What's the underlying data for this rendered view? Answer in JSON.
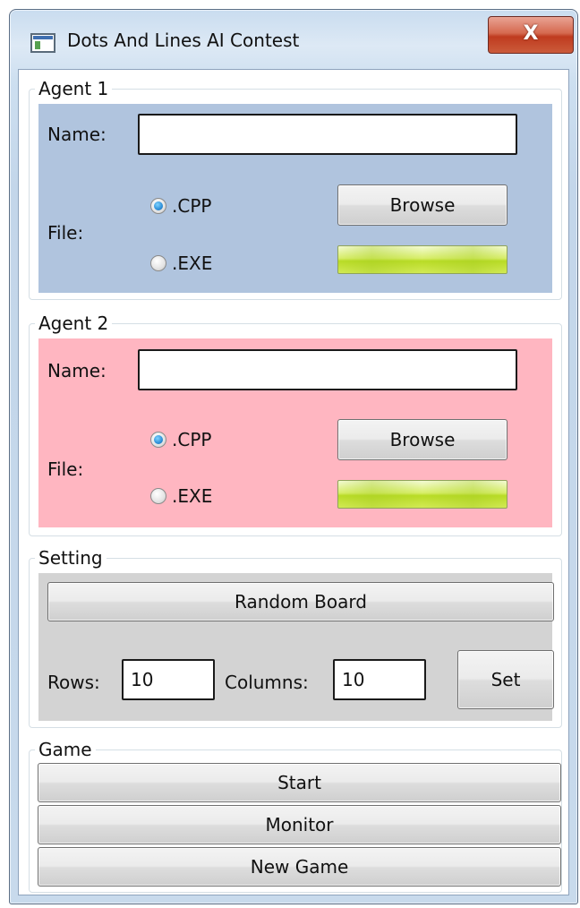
{
  "window": {
    "title": "Dots And Lines AI Contest",
    "close_glyph": "X"
  },
  "agent1": {
    "header": "Agent 1",
    "name_label": "Name:",
    "name_value": "",
    "file_label": "File:",
    "radio_cpp": ".CPP",
    "radio_exe": ".EXE",
    "selected": ".CPP",
    "browse_label": "Browse",
    "progress": 1.0,
    "panel_color": "#b0c4de"
  },
  "agent2": {
    "header": "Agent 2",
    "name_label": "Name:",
    "name_value": "",
    "file_label": "File:",
    "radio_cpp": ".CPP",
    "radio_exe": ".EXE",
    "selected": ".CPP",
    "browse_label": "Browse",
    "progress": 1.0,
    "panel_color": "#ffb6c1"
  },
  "setting": {
    "header": "Setting",
    "random_board_label": "Random Board",
    "rows_label": "Rows:",
    "rows_value": "10",
    "columns_label": "Columns:",
    "columns_value": "10",
    "set_label": "Set",
    "panel_color": "#d3d3d3"
  },
  "game": {
    "header": "Game",
    "start_label": "Start",
    "monitor_label": "Monitor",
    "new_game_label": "New Game"
  }
}
